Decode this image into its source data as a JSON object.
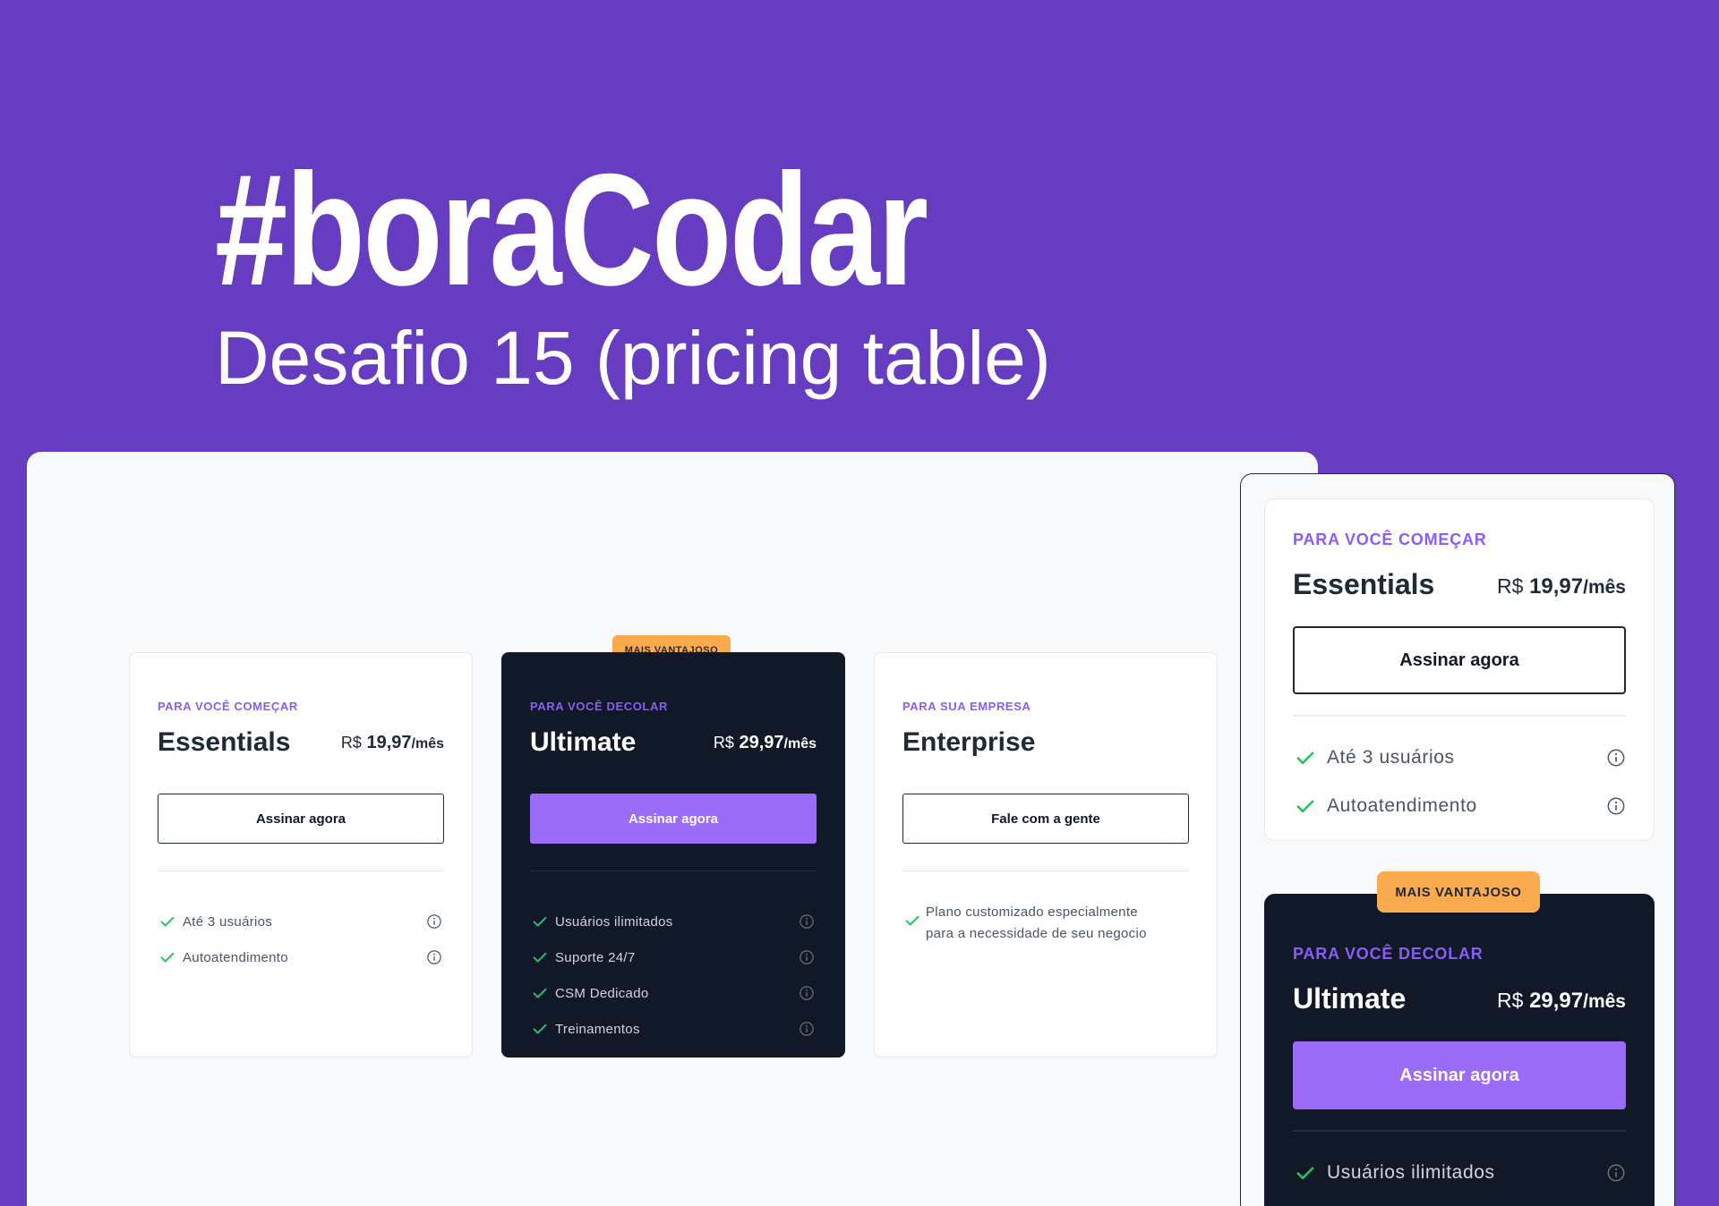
{
  "hero": {
    "title": "#boraCodar",
    "subtitle": "Desafio 15 (pricing table)"
  },
  "colors": {
    "background": "#663cc0",
    "accent": "#8b5cf6",
    "button_primary": "#9b6cf8",
    "badge": "#fbab4d",
    "dark_card": "#111827",
    "check": "#22c55e"
  },
  "icons": {
    "check": "check-icon",
    "info": "info-icon"
  },
  "pricing": {
    "badge": "MAIS VANTAJOSO",
    "plans": [
      {
        "eyebrow": "PARA VOCÊ COMEÇAR",
        "name": "Essentials",
        "currency": "R$",
        "amount": "19,97",
        "period": "/mês",
        "cta": "Assinar agora",
        "features": [
          "Até 3 usuários",
          "Autoatendimento"
        ]
      },
      {
        "eyebrow": "PARA VOCÊ DECOLAR",
        "name": "Ultimate",
        "currency": "R$",
        "amount": "29,97",
        "period": "/mês",
        "cta": "Assinar agora",
        "features": [
          "Usuários ilimitados",
          "Suporte 24/7",
          "CSM Dedicado",
          "Treinamentos"
        ]
      },
      {
        "eyebrow": "PARA SUA EMPRESA",
        "name": "Enterprise",
        "cta": "Fale com a gente",
        "description_lines": [
          "Plano customizado especialmente",
          "para a necessidade de seu negocio"
        ]
      }
    ]
  }
}
